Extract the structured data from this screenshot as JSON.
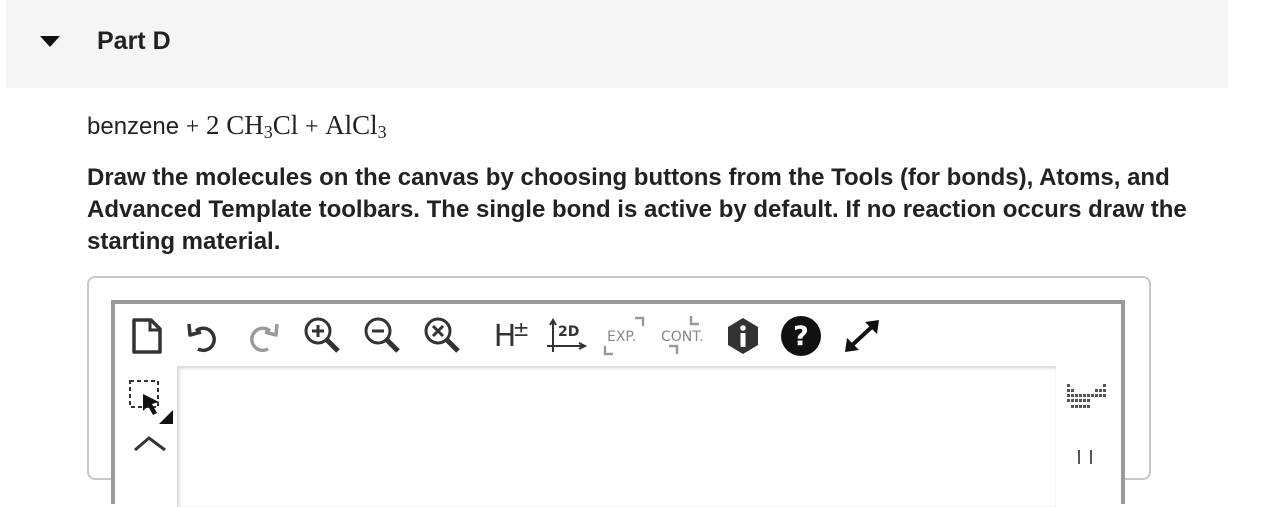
{
  "part": {
    "title": "Part D"
  },
  "reaction": {
    "word": "benzene",
    "plus": "+",
    "coef": "2",
    "reagent1_a": "CH",
    "reagent1_sub": "3",
    "reagent1_b": "Cl",
    "reagent2_a": "AlCl",
    "reagent2_sub": "3"
  },
  "instructions": "Draw the molecules on the canvas by choosing buttons from the Tools (for bonds), Atoms, and Advanced Template toolbars. The single bond is active by default. If no reaction occurs draw the starting material.",
  "toolbar": {
    "h_label": "H",
    "h_pm": "±",
    "twod_label": "2D",
    "exp_label": "EXP.",
    "cont_label": "CONT."
  },
  "icons": [
    "new-document-icon",
    "undo-icon",
    "redo-icon",
    "zoom-in-icon",
    "zoom-out-icon",
    "zoom-reset-icon",
    "explicit-hydrogens-icon",
    "clean-2d-icon",
    "expand-icon",
    "contract-icon",
    "info-icon",
    "help-icon",
    "fullscreen-icon",
    "selection-tool-icon",
    "periodic-table-icon"
  ]
}
